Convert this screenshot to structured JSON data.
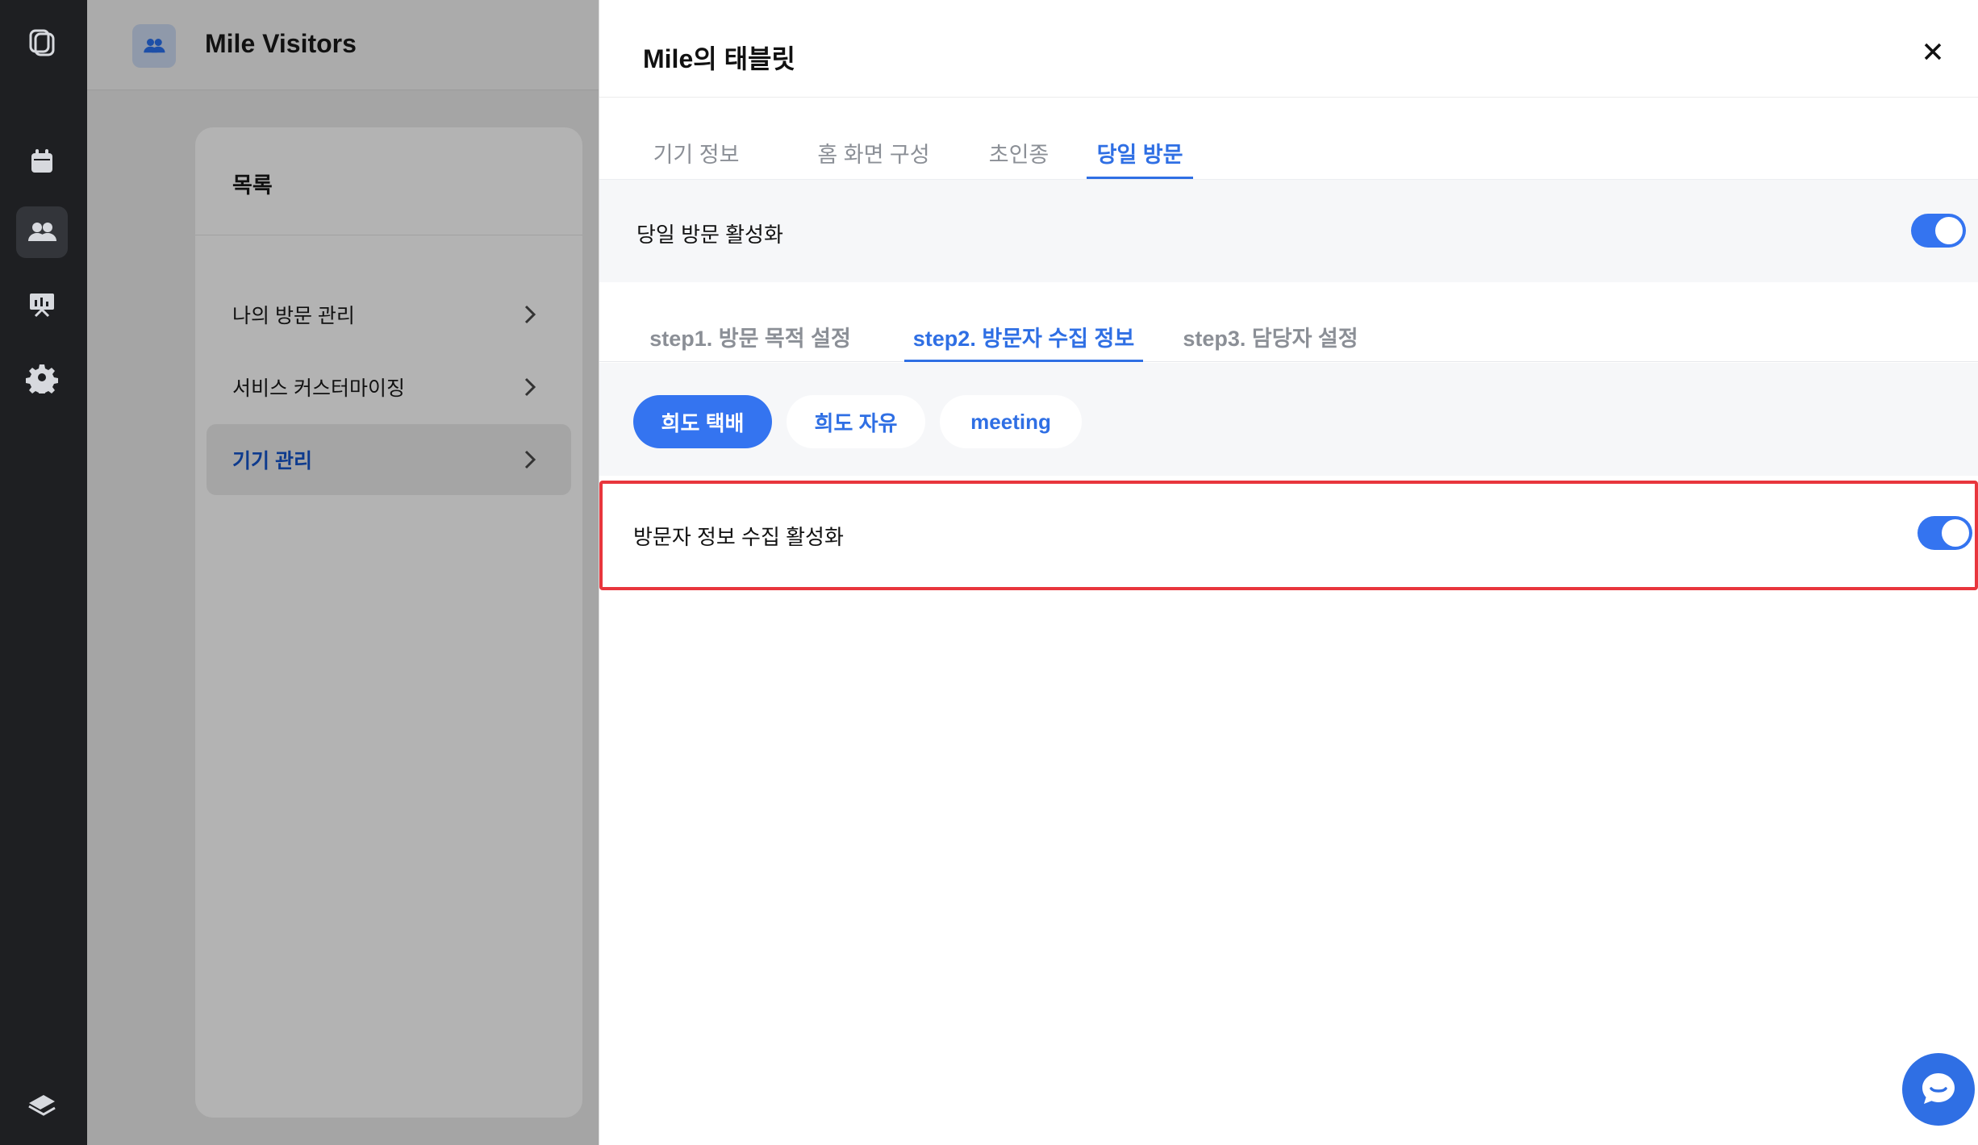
{
  "rail": {
    "items": [
      {
        "icon": "logo-icon"
      },
      {
        "icon": "calendar-icon"
      },
      {
        "icon": "users-icon",
        "active": true
      },
      {
        "icon": "presentation-icon"
      },
      {
        "icon": "gear-icon"
      },
      {
        "icon": "book-icon"
      }
    ]
  },
  "app": {
    "title": "Mile Visitors",
    "list_title": "목록",
    "menu": [
      {
        "label": "나의 방문 관리"
      },
      {
        "label": "서비스 커스터마이징"
      },
      {
        "label": "기기 관리",
        "active": true
      }
    ]
  },
  "modal": {
    "title": "Mile의 태블릿",
    "tabs": [
      "기기 정보",
      "홈 화면 구성",
      "초인종",
      "당일 방문"
    ],
    "active_tab": "당일 방문",
    "same_day_label": "당일 방문 활성화",
    "same_day_enabled": true,
    "steps": [
      "step1. 방문 목적 설정",
      "step2. 방문자 수집 정보",
      "step3. 담당자 설정"
    ],
    "active_step": "step2. 방문자 수집 정보",
    "chips": [
      "희도 택배",
      "희도 자유",
      "meeting"
    ],
    "active_chip": "희도 택배",
    "collect_label": "방문자 정보 수집 활성화",
    "collect_enabled": true
  },
  "colors": {
    "accent": "#3474f0",
    "highlight_border": "#e8363d",
    "rail_bg": "#1e1f22"
  }
}
